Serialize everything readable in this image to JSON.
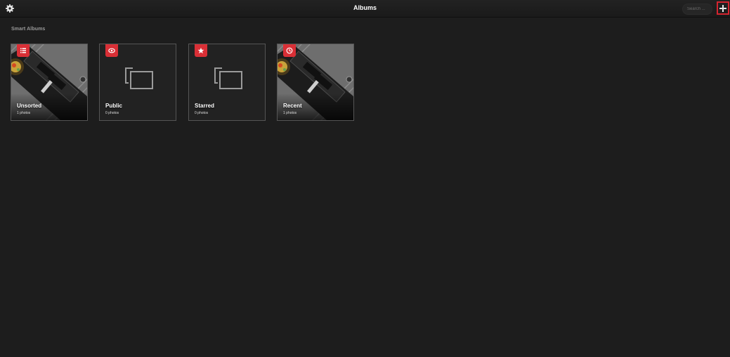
{
  "header": {
    "title": "Albums",
    "search_placeholder": "Search ...",
    "settings_icon": "gear-icon",
    "add_icon": "plus-icon"
  },
  "section": {
    "title": "Smart Albums"
  },
  "albums": [
    {
      "title": "Unsorted",
      "count": "1 photos",
      "icon": "list-icon",
      "has_thumb": true
    },
    {
      "title": "Public",
      "count": "0 photos",
      "icon": "eye-icon",
      "has_thumb": false
    },
    {
      "title": "Starred",
      "count": "0 photos",
      "icon": "star-icon",
      "has_thumb": false
    },
    {
      "title": "Recent",
      "count": "1 photos",
      "icon": "clock-icon",
      "has_thumb": true
    }
  ],
  "colors": {
    "background": "#1d1d1d",
    "accent": "#d92f36",
    "tile_border": "#555555"
  }
}
